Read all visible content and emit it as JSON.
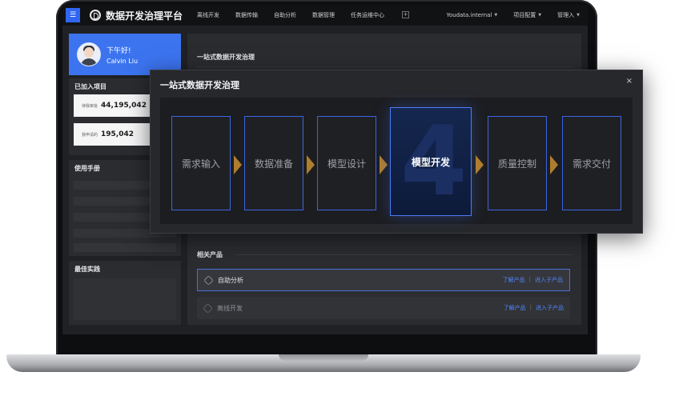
{
  "topbar": {
    "brand_title": "数据开发治理平台",
    "nav_items": [
      "离线开发",
      "数据传输",
      "自助分析",
      "数据管理",
      "任务运维中心"
    ],
    "plus": "+",
    "right_items": [
      "Youdata.internal",
      "项目配置",
      "管理入"
    ]
  },
  "user": {
    "greeting": "下午好!",
    "name": "Calvin Liu"
  },
  "projects": {
    "title": "已加入项目",
    "stats": [
      {
        "label": "待我审批",
        "value": "44,195,042"
      },
      {
        "label": "我申请的",
        "value": "195,042"
      }
    ]
  },
  "manual": {
    "title": "使用手册"
  },
  "best_practice": {
    "title": "最佳实践"
  },
  "main": {
    "header": "一站式数据开发治理"
  },
  "related": {
    "title": "相关产品",
    "products": [
      {
        "name": "自助分析",
        "learn": "了解产品",
        "sep": "|",
        "enter": "进入子产品"
      },
      {
        "name": "离线开发",
        "learn": "了解产品",
        "sep": "|",
        "enter": "进入子产品"
      }
    ]
  },
  "modal": {
    "title": "一站式数据开发治理",
    "close": "×",
    "steps": [
      "需求输入",
      "数据准备",
      "模型设计",
      "模型开发",
      "质量控制",
      "需求交付"
    ],
    "active_step_number": "4"
  },
  "colors": {
    "accent": "#3c74f0",
    "link": "#4f86ff",
    "arrow": "#b07d2e"
  }
}
